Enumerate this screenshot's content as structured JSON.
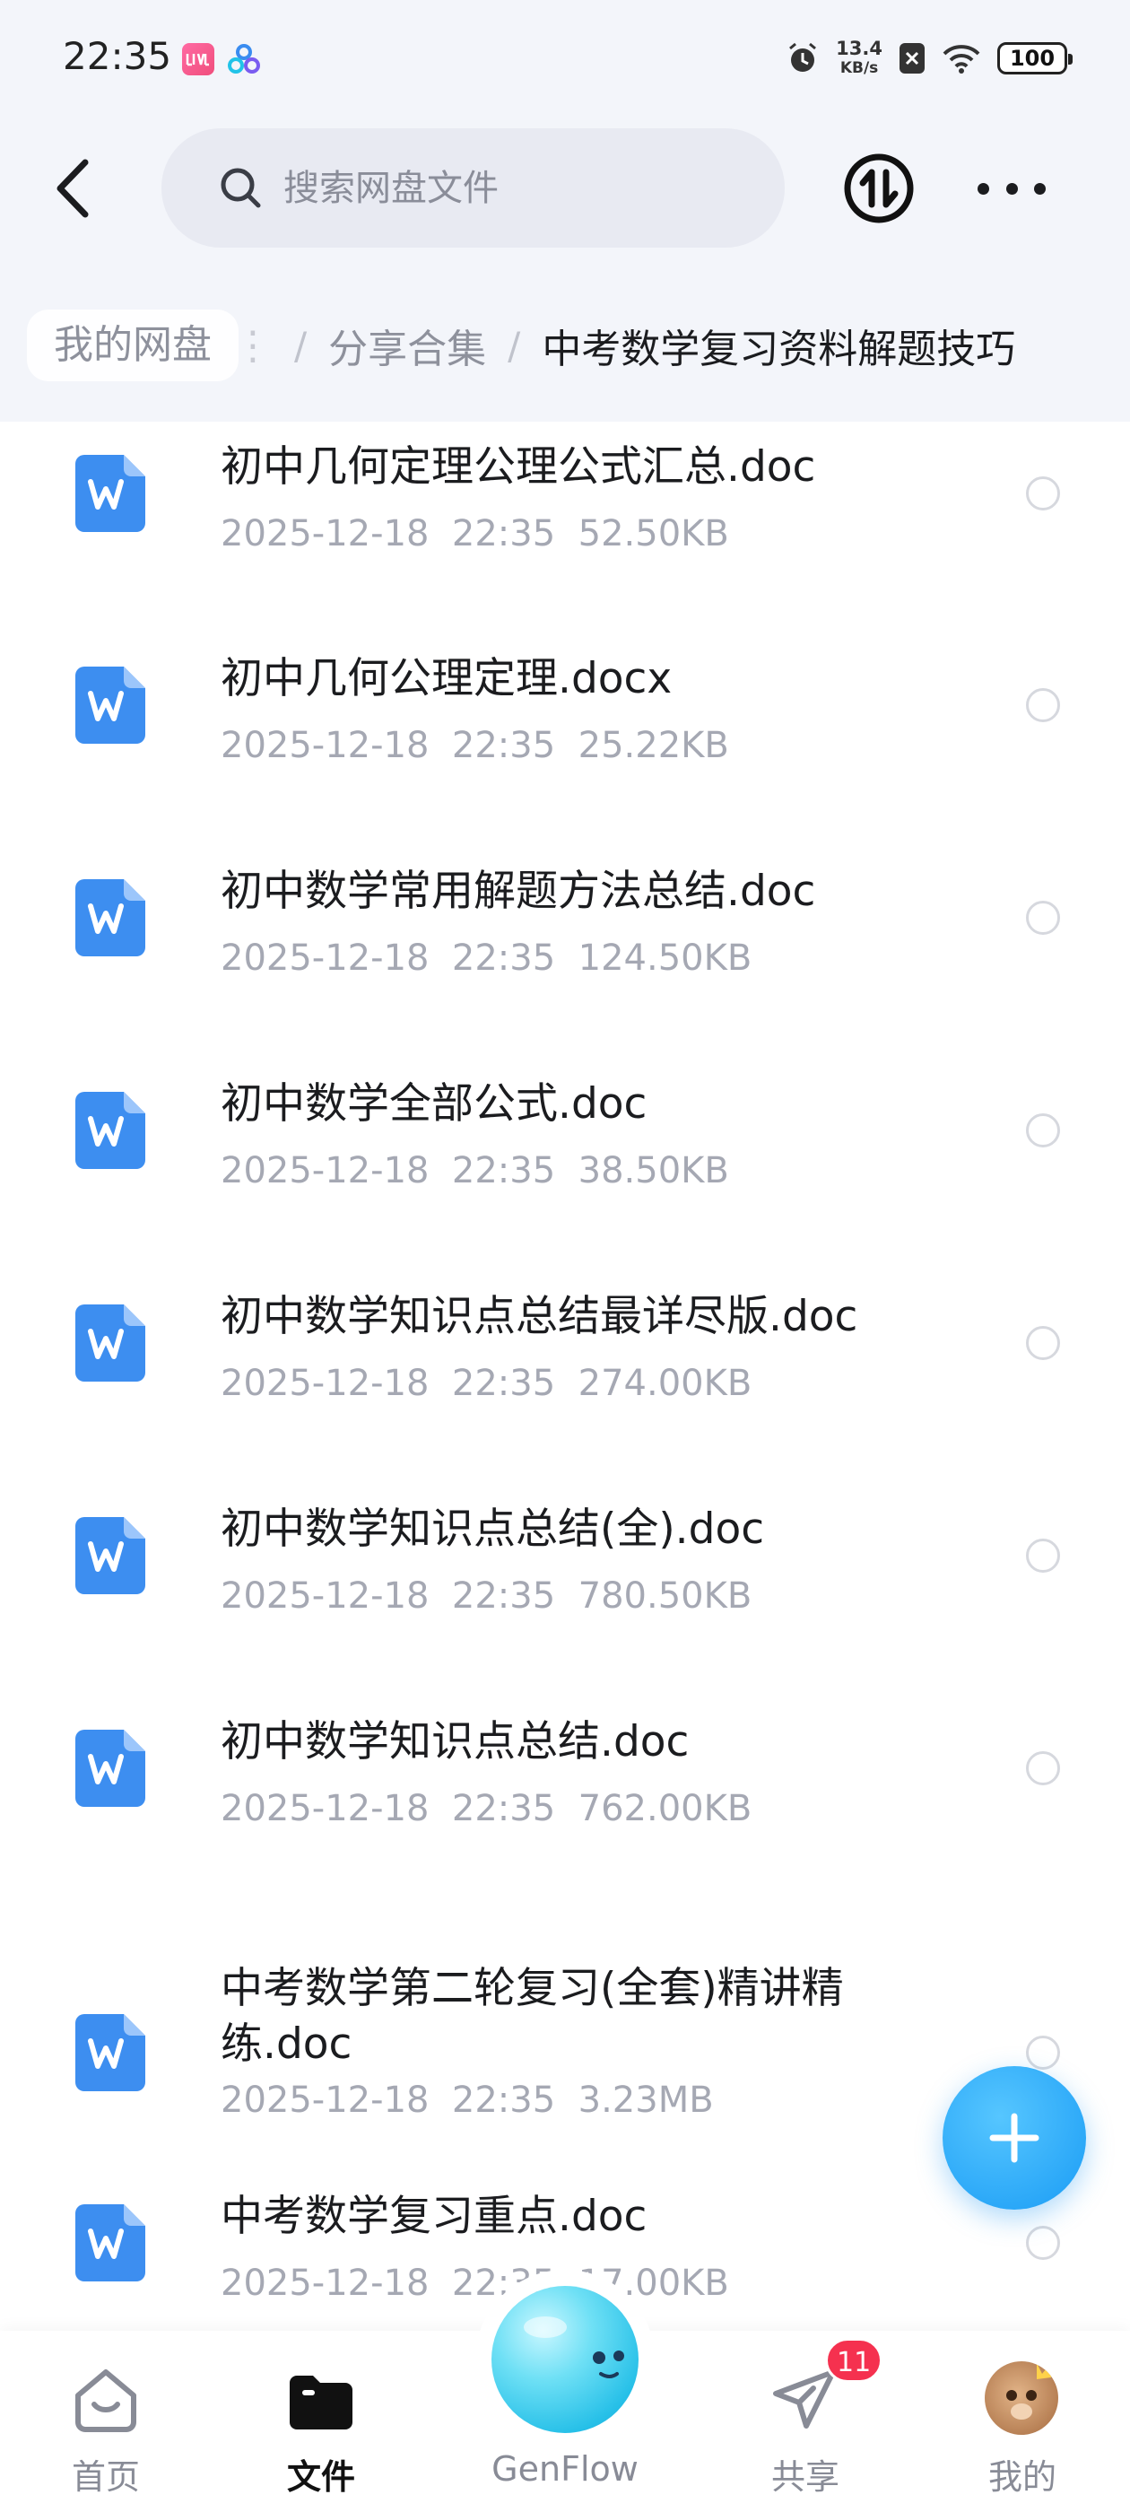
{
  "status_bar": {
    "time": "22:35",
    "net_speed_value": "13.4",
    "net_speed_unit": "KB/s",
    "battery": "100"
  },
  "header": {
    "search_placeholder": "搜索网盘文件"
  },
  "breadcrumb": {
    "root": "我的网盘",
    "hidden_fragment": "⋮",
    "parent": "分享合集",
    "current": "中考数学复习资料解题技巧"
  },
  "files": [
    {
      "name": "初中几何定理公理公式汇总.doc",
      "date": "2025-12-18",
      "time": "22:35",
      "size": "52.50KB"
    },
    {
      "name": "初中几何公理定理.docx",
      "date": "2025-12-18",
      "time": "22:35",
      "size": "25.22KB"
    },
    {
      "name": "初中数学常用解题方法总结.doc",
      "date": "2025-12-18",
      "time": "22:35",
      "size": "124.50KB"
    },
    {
      "name": "初中数学全部公式.doc",
      "date": "2025-12-18",
      "time": "22:35",
      "size": "38.50KB"
    },
    {
      "name": "初中数学知识点总结最详尽版.doc",
      "date": "2025-12-18",
      "time": "22:35",
      "size": "274.00KB"
    },
    {
      "name": "初中数学知识点总结(全).doc",
      "date": "2025-12-18",
      "time": "22:35",
      "size": "780.50KB"
    },
    {
      "name": "初中数学知识点总结.doc",
      "date": "2025-12-18",
      "time": "22:35",
      "size": "762.00KB"
    },
    {
      "name": "中考数学第二轮复习(全套)精讲精练.doc",
      "date": "2025-12-18",
      "time": "22:35",
      "size": "3.23MB"
    },
    {
      "name": "中考数学复习重点.doc",
      "date": "2025-12-18",
      "time": "22:35",
      "size": "17.00KB"
    }
  ],
  "file_icon": "word-doc-icon",
  "bottom_nav": {
    "home": "首页",
    "files": "文件",
    "genflow": "GenFlow",
    "share": "共享",
    "mine": "我的",
    "share_badge": "11"
  },
  "colors": {
    "accent": "#1a9cf5",
    "badge": "#f5314f",
    "word_icon": "#3d8ef0"
  }
}
